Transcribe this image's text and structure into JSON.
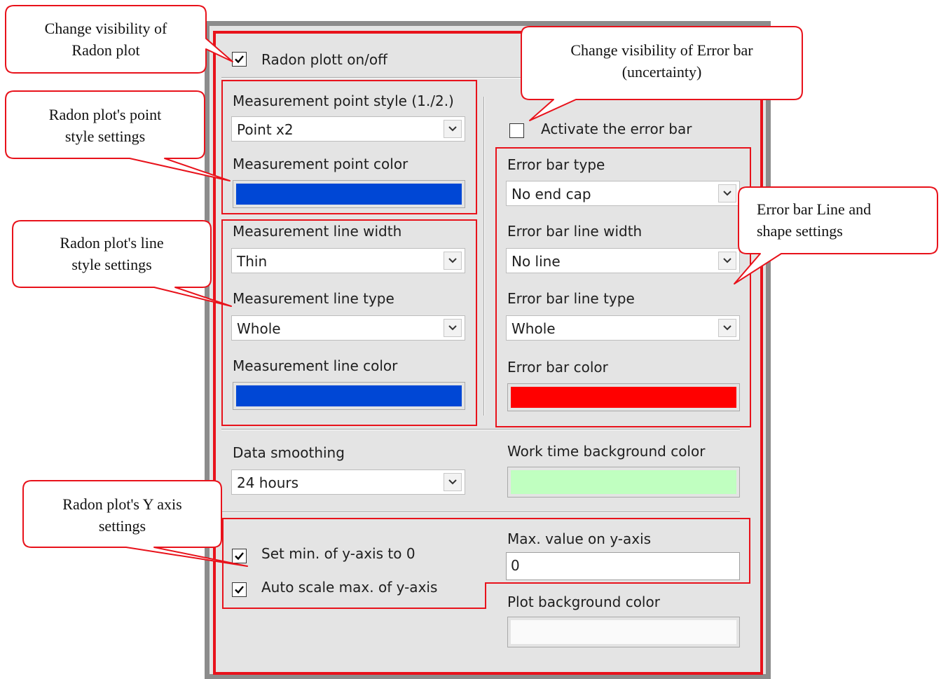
{
  "panel": {
    "radon_toggle": {
      "label": "Radon plott on/off",
      "checked": true
    },
    "point_style": {
      "label": "Measurement point style (1./2.)",
      "value": "Point x2"
    },
    "point_color": {
      "label": "Measurement point color",
      "color": "#0047d5"
    },
    "line_width": {
      "label": "Measurement line width",
      "value": "Thin"
    },
    "line_type": {
      "label": "Measurement line type",
      "value": "Whole"
    },
    "line_color": {
      "label": "Measurement line color",
      "color": "#0047d5"
    },
    "error_toggle": {
      "label": "Activate the error bar",
      "checked": false
    },
    "error_type": {
      "label": "Error bar type",
      "value": "No end cap"
    },
    "error_width": {
      "label": "Error bar line width",
      "value": "No line"
    },
    "error_line_type": {
      "label": "Error bar line type",
      "value": "Whole"
    },
    "error_color": {
      "label": "Error bar color",
      "color": "#ff0000"
    },
    "smoothing": {
      "label": "Data smoothing",
      "value": "24 hours"
    },
    "worktime_bg": {
      "label": "Work time background color",
      "color": "#c0ffc0"
    },
    "min_zero": {
      "label": "Set min. of y-axis to 0",
      "checked": true
    },
    "auto_scale": {
      "label": "Auto scale max. of y-axis",
      "checked": true
    },
    "max_y": {
      "label": "Max. value on y-axis",
      "value": "0"
    },
    "plot_bg": {
      "label": "Plot background color",
      "color": "#fafafa"
    }
  },
  "callouts": {
    "visibility": [
      "Change visibility of",
      "Radon plot"
    ],
    "point_style": [
      "Radon plot's point",
      "style settings"
    ],
    "line_style": [
      "Radon plot's line",
      "style settings"
    ],
    "y_axis": [
      "Radon plot's Y axis",
      "settings"
    ],
    "error_visibility": [
      "Change visibility of Error bar",
      "(uncertainty)"
    ],
    "error_line": [
      "Error bar Line and",
      "shape settings"
    ]
  },
  "colors": {
    "highlight": "#e8121b"
  }
}
